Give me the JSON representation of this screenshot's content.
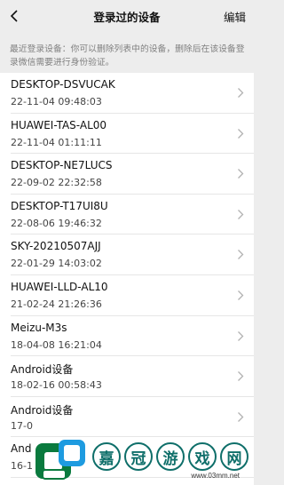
{
  "nav": {
    "title": "登录过的设备",
    "edit_label": "编辑"
  },
  "notice": "最近登录设备：你可以删除列表中的设备，删除后在该设备登录微信需要进行身份验证。",
  "devices": [
    {
      "name": "DESKTOP-DSVUCAK",
      "time": "22-11-04 09:48:03"
    },
    {
      "name": "HUAWEI-TAS-AL00",
      "time": "22-11-04 01:11:11"
    },
    {
      "name": "DESKTOP-NE7LUCS",
      "time": "22-09-02 22:32:58"
    },
    {
      "name": "DESKTOP-T17UI8U",
      "time": "22-08-06 19:46:32"
    },
    {
      "name": "SKY-20210507AJJ",
      "time": "22-01-29 14:03:02"
    },
    {
      "name": "HUAWEI-LLD-AL10",
      "time": "21-02-24 21:26:36"
    },
    {
      "name": "Meizu-M3s",
      "time": "18-04-08 16:21:04"
    },
    {
      "name": "Android设备",
      "time": "18-02-16 00:58:43"
    },
    {
      "name": "Android设备",
      "time": "17-0"
    },
    {
      "name": "And",
      "time": "16-1"
    }
  ],
  "watermark": {
    "chars": [
      "嘉",
      "冠",
      "游",
      "戏",
      "网"
    ],
    "url": "www.03mm.net",
    "color": "#0f6f6a"
  }
}
